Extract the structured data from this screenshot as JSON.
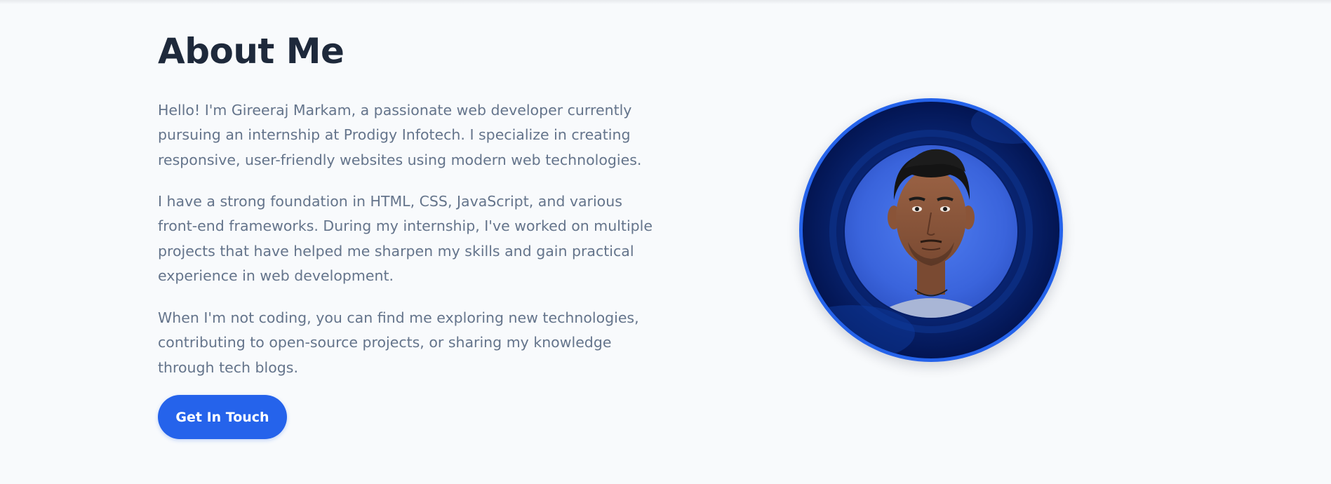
{
  "about": {
    "title": "About Me",
    "paragraphs": [
      "Hello! I'm Gireeraj Markam, a passionate web developer currently pursuing an internship at Prodigy Infotech. I specialize in creating responsive, user-friendly websites using modern web technologies.",
      "I have a strong foundation in HTML, CSS, JavaScript, and various front-end frameworks. During my internship, I've worked on multiple projects that have helped me sharpen my skills and gain practical experience in web development.",
      "When I'm not coding, you can find me exploring new technologies, contributing to open-source projects, or sharing my knowledge through tech blogs."
    ],
    "cta_label": "Get In Touch"
  },
  "profile_photo": {
    "subject": "portrait-of-gireeraj-markam",
    "ring_color": "#2563eb",
    "backdrop_color": "#0a2a7a"
  },
  "colors": {
    "background": "#f8fafc",
    "heading": "#1e293b",
    "body_text": "#64748b",
    "accent": "#2563eb"
  }
}
